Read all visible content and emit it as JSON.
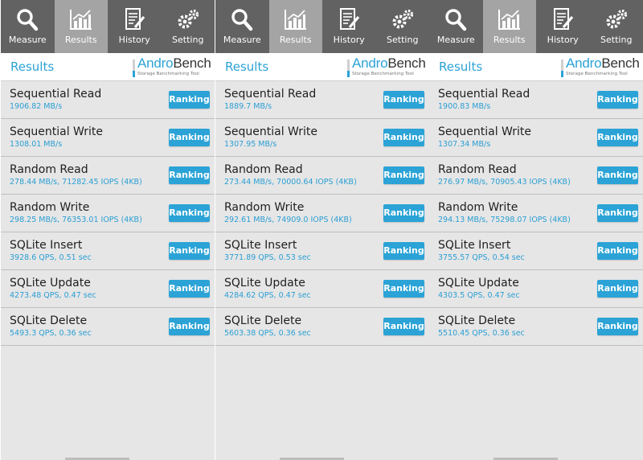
{
  "tabs": [
    {
      "label": "Measure",
      "icon": "magnifier-icon"
    },
    {
      "label": "Results",
      "icon": "bar-chart-icon"
    },
    {
      "label": "History",
      "icon": "document-edit-icon"
    },
    {
      "label": "Setting",
      "icon": "gears-icon"
    }
  ],
  "active_tab": "Results",
  "header_title": "Results",
  "brand": {
    "part1": "Andro",
    "part2": "Bench",
    "tagline": "Storage Benchmarking Tool"
  },
  "ranking_label": "Ranking",
  "test_names": [
    "Sequential Read",
    "Sequential Write",
    "Random Read",
    "Random Write",
    "SQLite Insert",
    "SQLite Update",
    "SQLite Delete"
  ],
  "panels": [
    {
      "results": [
        "1906.82 MB/s",
        "1308.01 MB/s",
        "278.44 MB/s, 71282.45 IOPS (4KB)",
        "298.25 MB/s, 76353.01 IOPS (4KB)",
        "3928.6 QPS, 0.51 sec",
        "4273.48 QPS, 0.47 sec",
        "5493.3 QPS, 0.36 sec"
      ]
    },
    {
      "results": [
        "1889.7 MB/s",
        "1307.95 MB/s",
        "273.44 MB/s, 70000.64 IOPS (4KB)",
        "292.61 MB/s, 74909.0 IOPS (4KB)",
        "3771.89 QPS, 0.53 sec",
        "4284.62 QPS, 0.47 sec",
        "5603.38 QPS, 0.36 sec"
      ]
    },
    {
      "results": [
        "1900.83 MB/s",
        "1307.34 MB/s",
        "276.97 MB/s, 70905.43 IOPS (4KB)",
        "294.13 MB/s, 75298.07 IOPS (4KB)",
        "3755.57 QPS, 0.54 sec",
        "4303.5 QPS, 0.47 sec",
        "5510.45 QPS, 0.36 sec"
      ]
    }
  ],
  "colors": {
    "accent": "#2ba3d6",
    "tabbar": "#626262",
    "tab_active": "#a4a4a4",
    "list_bg": "#e6e6e6"
  }
}
